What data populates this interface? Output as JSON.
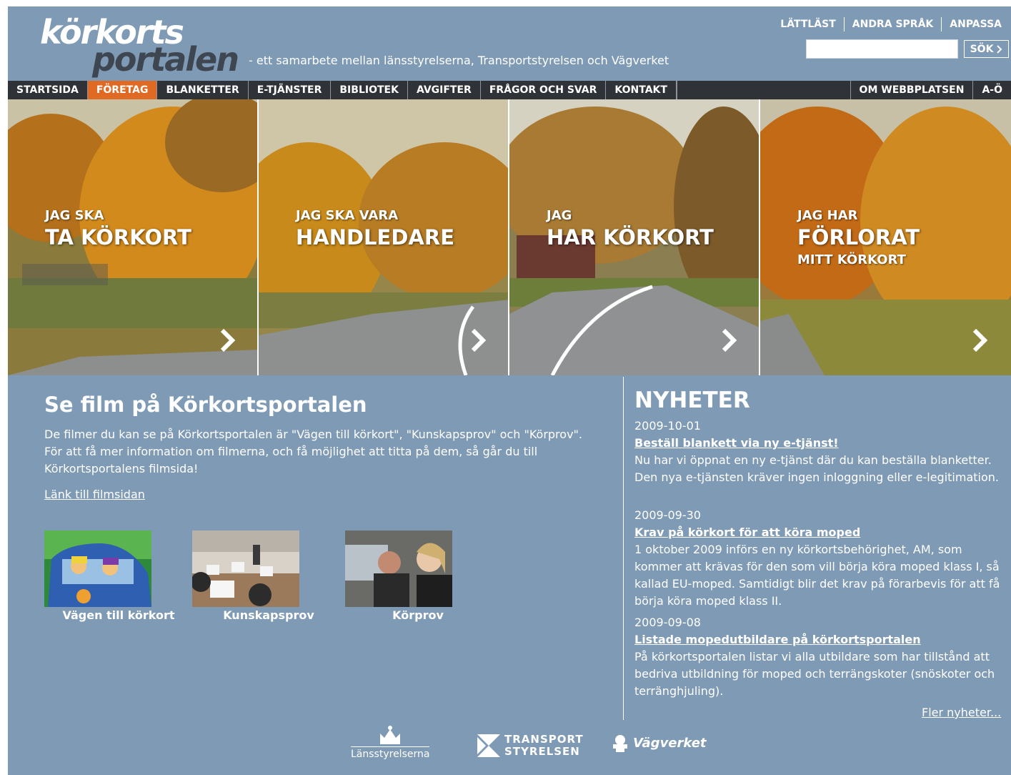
{
  "header": {
    "logo_line1": "körkorts",
    "logo_line2": "portalen",
    "tagline": "- ett samarbete mellan länsstyrelserna, Transportstyrelsen och Vägverket",
    "top_links": [
      "LÄTTLÄST",
      "ANDRA SPRÅK",
      "ANPASSA"
    ],
    "search": {
      "placeholder": "",
      "button_label": "SÖK"
    }
  },
  "nav": {
    "items": [
      "STARTSIDA",
      "FÖRETAG",
      "BLANKETTER",
      "E-TJÄNSTER",
      "BIBLIOTEK",
      "AVGIFTER",
      "FRÅGOR OCH SVAR",
      "KONTAKT"
    ],
    "active": "FÖRETAG",
    "right_items": [
      "OM WEBBPLATSEN",
      "A-Ö"
    ]
  },
  "hero": {
    "panels": [
      {
        "small": "JAG SKA",
        "big": "TA KÖRKORT",
        "sub": ""
      },
      {
        "small": "JAG SKA VARA",
        "big": "HANDLEDARE",
        "sub": ""
      },
      {
        "small": "JAG",
        "big": "HAR KÖRKORT",
        "sub": ""
      },
      {
        "small": "JAG HAR",
        "big": "FÖRLORAT",
        "sub": "MITT KÖRKORT"
      }
    ]
  },
  "film": {
    "title": "Se film på Körkortsportalen",
    "text": "De filmer du kan se på Körkortsportalen är \"Vägen till körkort\", \"Kunskapsprov\" och \"Körprov\". För att få mer information om filmerna, och få möjlighet att titta på dem, så går du till Körkortsportalens filmsida!",
    "link": "Länk till filmsidan",
    "videos": [
      "Vägen till körkort",
      "Kunskapsprov",
      "Körprov"
    ]
  },
  "news": {
    "title": "NYHETER",
    "items": [
      {
        "date": "2009-10-01",
        "headline": "Beställ blankett via ny e-tjänst!",
        "body": "Nu har vi öppnat en ny e-tjänst där du kan beställa blanketter. Den nya e-tjänsten kräver ingen inloggning eller e-legitimation."
      },
      {
        "date": "2009-09-30",
        "headline": "Krav på körkort för att köra moped",
        "body": "1 oktober 2009 införs en ny körkortsbehörighet, AM, som kommer att krävas för den som vill börja köra moped klass I, så kallad EU-moped. Samtidigt blir det krav på förarbevis för att få börja köra moped klass II."
      },
      {
        "date": "2009-09-08",
        "headline": "Listade mopedutbildare på körkortsportalen",
        "body": "På körkortsportalen listar vi alla utbildare som har tillstånd att bedriva utbildning för moped och terrängskoter (snöskoter och terränghjuling)."
      }
    ],
    "more": "Fler nyheter..."
  },
  "footer": {
    "logos": [
      "Länsstyrelserna",
      "TRANSPORT",
      "STYRELSEN",
      "Vägverket"
    ]
  },
  "colors": {
    "page_bg": "#7f9ab4",
    "nav_bg": "#2f3337",
    "nav_active": "#e06a24"
  }
}
